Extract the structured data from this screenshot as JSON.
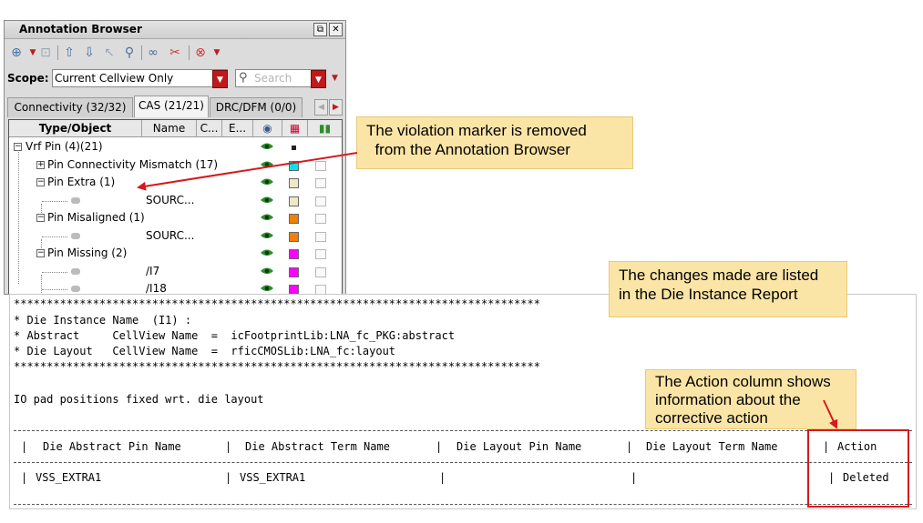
{
  "browser": {
    "title": "Annotation Browser",
    "scope_label": "Scope:",
    "scope_value": "Current Cellview Only",
    "search_placeholder": "Search",
    "tabs": [
      "Connectivity (32/32)",
      "CAS (21/21)",
      "DRC/DFM (0/0)"
    ],
    "active_tab": 1,
    "columns": [
      "Type/Object",
      "Name",
      "C...",
      "E..."
    ],
    "rows": [
      {
        "label": "Vrf Pin (4)(21)",
        "name": "",
        "swatch": "#222222"
      },
      {
        "label": "Pin Connectivity Mismatch (17)",
        "name": "",
        "swatch": "#00e5ee"
      },
      {
        "label": "Pin Extra (1)",
        "name": "",
        "swatch": "#efe7c6"
      },
      {
        "label": "",
        "name": "SOURC...",
        "swatch": "#efe7c6"
      },
      {
        "label": "Pin Misaligned (1)",
        "name": "",
        "swatch": "#f08000"
      },
      {
        "label": "",
        "name": "SOURC...",
        "swatch": "#f08000"
      },
      {
        "label": "Pin Missing (2)",
        "name": "",
        "swatch": "#ff00ff"
      },
      {
        "label": "",
        "name": "/I7",
        "swatch": "#ff00ff"
      },
      {
        "label": "",
        "name": "/I18",
        "swatch": "#ff00ff"
      }
    ]
  },
  "report": {
    "stars": "********************************************************************************",
    "die_instance_label": "* Die Instance Name  (I1) :",
    "abstract_line": "* Abstract     CellView Name  =  icFootprintLib:LNA_fc_PKG:abstract",
    "layout_line": "* Die Layout   CellView Name  =  rficCMOSLib:LNA_fc:layout",
    "stars_bottom": "********************************************************************************",
    "fixed_line": "IO pad positions fixed wrt. die layout",
    "headers": [
      "Die Abstract Pin Name",
      "Die Abstract Term Name",
      "Die Layout Pin Name",
      "Die Layout Term Name",
      "Action"
    ],
    "row": [
      "VSS_EXTRA1",
      "VSS_EXTRA1",
      "",
      "",
      "Deleted"
    ]
  },
  "callouts": {
    "violation": "The violation marker is removed\n  from the Annotation Browser",
    "changes": "The changes made are listed\nin the Die Instance Report",
    "action": "The Action column shows\ninformation about the\ncorrective action"
  },
  "colors": {
    "callout_fill": "#fbe5a6",
    "highlight": "#d7191c",
    "eye": "#2e8b2e"
  }
}
